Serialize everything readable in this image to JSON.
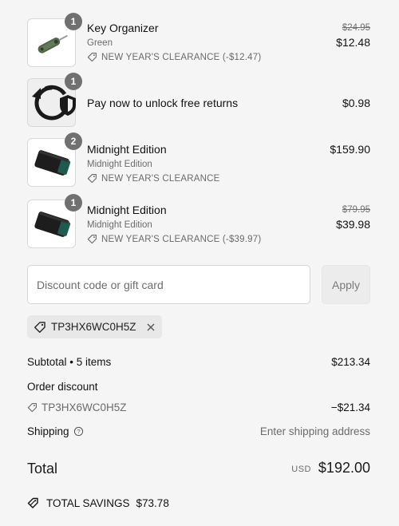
{
  "items": [
    {
      "name": "Key Organizer",
      "variant": "Green",
      "promo": "NEW YEAR'S CLEARANCE (-$12.47)",
      "compare_price": "$24.95",
      "price": "$12.48",
      "quantity": "1",
      "thumb_icon": "key-organizer-image"
    },
    {
      "name": "Pay now to unlock free returns",
      "variant": "",
      "promo": "",
      "compare_price": "",
      "price": "$0.98",
      "quantity": "1",
      "thumb_icon": "return-shield-icon"
    },
    {
      "name": "Midnight Edition",
      "variant": "Midnight Edition",
      "promo": "NEW YEAR'S CLEARANCE",
      "compare_price": "",
      "price": "$159.90",
      "quantity": "2",
      "thumb_icon": "wallet-image"
    },
    {
      "name": "Midnight Edition",
      "variant": "Midnight Edition",
      "promo": "NEW YEAR'S CLEARANCE (-$39.97)",
      "compare_price": "$79.95",
      "price": "$39.98",
      "quantity": "1",
      "thumb_icon": "wallet-image"
    }
  ],
  "discount": {
    "placeholder": "Discount code or gift card",
    "value": "",
    "apply_label": "Apply",
    "applied_code": "TP3HX6WC0H5Z"
  },
  "summary": {
    "subtotal_label": "Subtotal • 5 items",
    "subtotal_value": "$213.34",
    "order_discount_label": "Order discount",
    "order_discount_code": "TP3HX6WC0H5Z",
    "order_discount_value": "−$21.34",
    "shipping_label": "Shipping",
    "shipping_value": "Enter shipping address",
    "total_label": "Total",
    "currency": "USD",
    "total_value": "$192.00",
    "savings_label": "TOTAL SAVINGS",
    "savings_value": "$73.78"
  },
  "colors": {
    "background": "#f5f5f5",
    "badge": "#707070",
    "muted_text": "#6b6b6b",
    "wallet_green": "#1f5a4e",
    "organizer_green": "#556b4c"
  }
}
